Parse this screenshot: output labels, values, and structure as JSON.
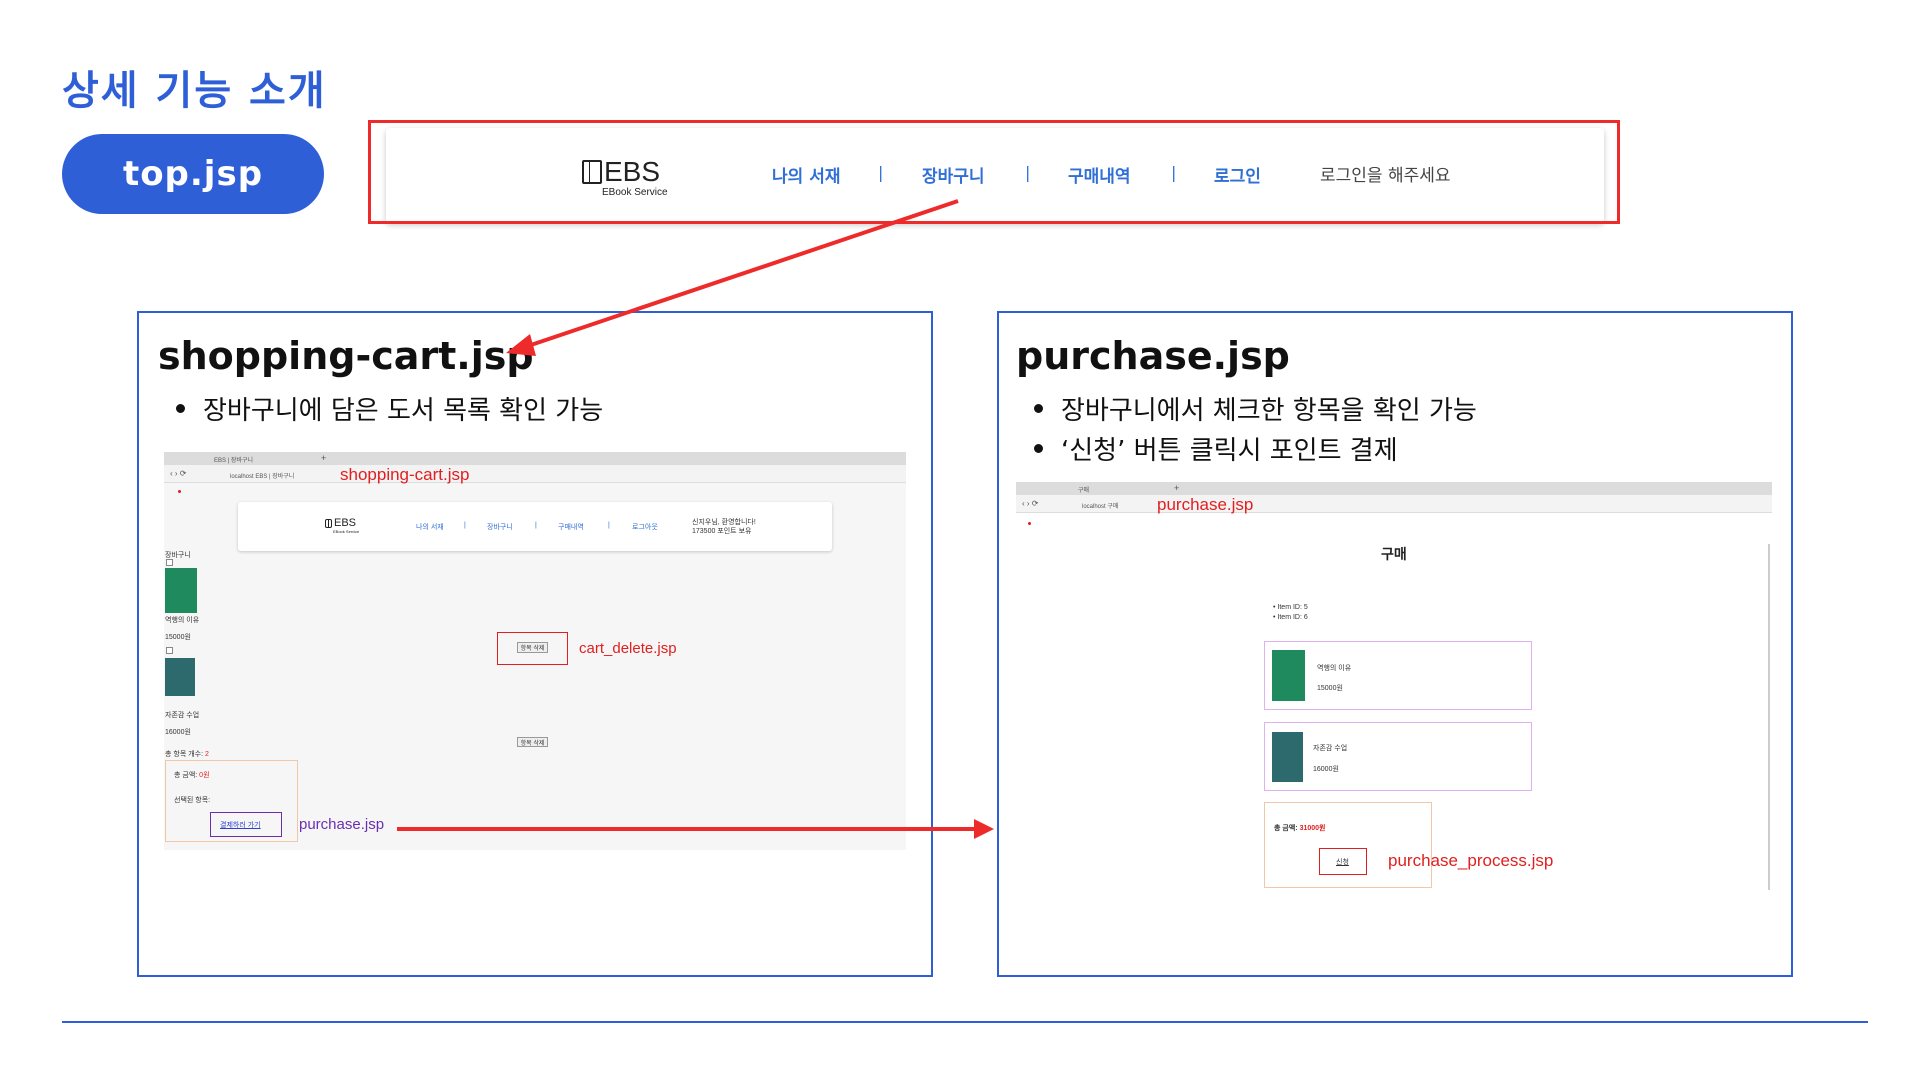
{
  "slide": {
    "title": "상세 기능 소개",
    "pill_label": "top.jsp"
  },
  "top_bar": {
    "logo": "EBS",
    "logo_sub": "EBook Service",
    "nav": [
      "나의 서재",
      "장바구니",
      "구매내역",
      "로그인"
    ],
    "separator": "|",
    "login_message": "로그인을 해주세요"
  },
  "cart_panel": {
    "title": "shopping-cart.jsp",
    "bullets": [
      "장바구니에 담은 도서 목록 확인 가능"
    ],
    "shot": {
      "tab_label": "EBS | 장바구니",
      "address": "localhost  EBS | 장바구니",
      "page_label": "shopping-cart.jsp",
      "nav": [
        "나의 서재",
        "장바구니",
        "구매내역",
        "로그아웃"
      ],
      "user_message_1": "신지우님, 환영합니다!",
      "user_message_2": "173500 포인트 보유",
      "heading": "장바구니",
      "items": [
        {
          "name": "역행의 이유",
          "price": "15000원"
        },
        {
          "name": "자존감 수업",
          "price": "16000원"
        }
      ],
      "delete_button": "항목 삭제",
      "delete_label": "cart_delete.jsp",
      "total_count_label": "총 항목 개수:",
      "total_count_value": "2",
      "total_price_label": "총 금액:",
      "total_price_value": "0원",
      "selected_label": "선택된 항목:",
      "checkout_button": "결제하러 가기",
      "checkout_label": "purchase.jsp"
    }
  },
  "purchase_panel": {
    "title": "purchase.jsp",
    "bullets": [
      "장바구니에서 체크한 항목을 확인 가능",
      "‘신청’ 버튼 클릭시 포인트 결제"
    ],
    "shot": {
      "tab_label": "구매",
      "address": "localhost  구매",
      "page_label": "purchase.jsp",
      "heading": "구매",
      "item_ids": [
        "Item ID: 5",
        "Item ID: 6"
      ],
      "items": [
        {
          "name": "역행의 이유",
          "price": "15000원"
        },
        {
          "name": "자존감 수업",
          "price": "16000원"
        }
      ],
      "total_label": "총 금액:",
      "total_value": "31000원",
      "apply_button": "신청",
      "apply_label": "purchase_process.jsp"
    }
  },
  "colors": {
    "accent": "#2f5fd6",
    "highlight": "#ee2b2b",
    "link": "#2f6fd6",
    "purple": "#6a2fb0"
  }
}
